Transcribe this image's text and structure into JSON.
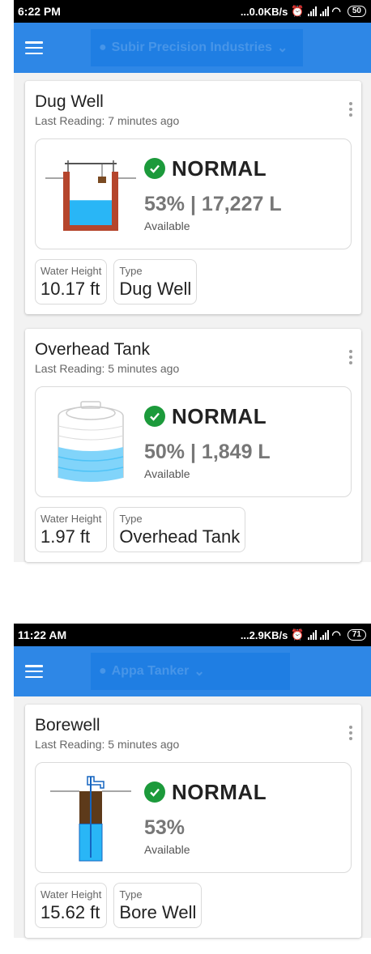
{
  "screens": [
    {
      "status_bar": {
        "time": "6:22 PM",
        "net": "...0.0KB/s",
        "battery": "50"
      },
      "header": {
        "site_name": "Subir Precision Industries"
      },
      "cards": [
        {
          "title": "Dug Well",
          "last_reading": "Last Reading: 7 minutes ago",
          "status": "NORMAL",
          "level_text": "53% | 17,227 L",
          "available_label": "Available",
          "fill_percent": 53,
          "chips": [
            {
              "label": "Water Height",
              "value": "10.17 ft"
            },
            {
              "label": "Type",
              "value": "Dug Well"
            }
          ]
        },
        {
          "title": "Overhead Tank",
          "last_reading": "Last Reading: 5 minutes ago",
          "status": "NORMAL",
          "level_text": "50% | 1,849 L",
          "available_label": "Available",
          "fill_percent": 50,
          "chips": [
            {
              "label": "Water Height",
              "value": "1.97 ft"
            },
            {
              "label": "Type",
              "value": "Overhead Tank"
            }
          ]
        }
      ]
    },
    {
      "status_bar": {
        "time": "11:22 AM",
        "net": "...2.9KB/s",
        "battery": "71"
      },
      "header": {
        "site_name": "Appa Tanker"
      },
      "cards": [
        {
          "title": "Borewell",
          "last_reading": "Last Reading: 5 minutes ago",
          "status": "NORMAL",
          "level_text": "53%",
          "available_label": "Available",
          "fill_percent": 53,
          "chips": [
            {
              "label": "Water Height",
              "value": "15.62 ft"
            },
            {
              "label": "Type",
              "value": "Bore Well"
            }
          ]
        }
      ]
    }
  ],
  "colors": {
    "appbar": "#2e87e6",
    "ok": "#1c9a3b",
    "water": "#29b6f6",
    "brick": "#b5452c",
    "soil": "#5d3a1a"
  }
}
